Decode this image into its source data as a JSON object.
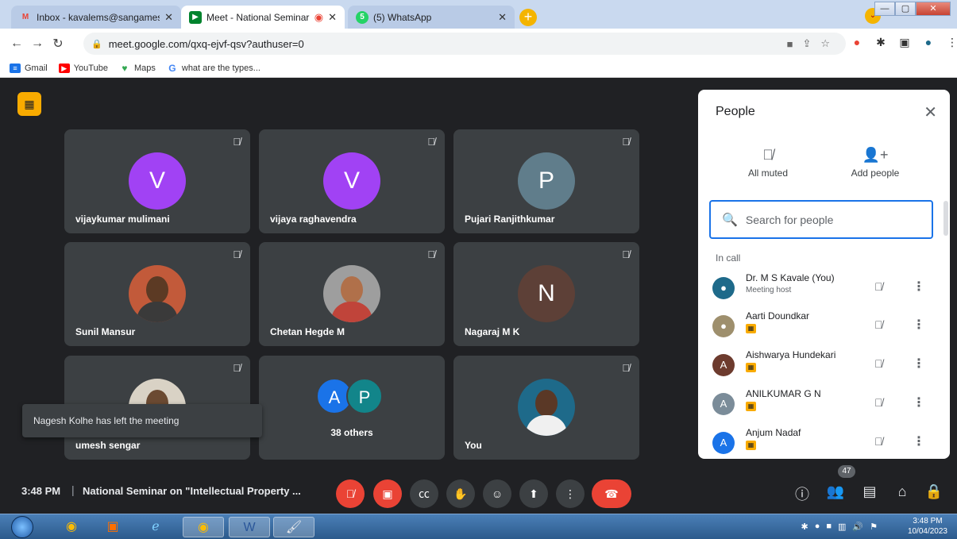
{
  "browser": {
    "tabs": [
      {
        "title": "Inbox - kavalems@sangameshwa",
        "icon": "gmail-icon",
        "state": "inactive"
      },
      {
        "title": "Meet - National Seminar on",
        "icon": "meet-icon",
        "state": "active"
      },
      {
        "title": "(5) WhatsApp",
        "icon": "whatsapp-icon",
        "state": "inactive"
      }
    ],
    "new_tab": "+",
    "url": "meet.google.com/qxq-ejvf-qsv?authuser=0",
    "bookmarks": [
      {
        "label": "Gmail",
        "color": "#1a73e8"
      },
      {
        "label": "YouTube",
        "color": "#ff0000"
      },
      {
        "label": "Maps",
        "color": "#34a853"
      },
      {
        "label": "what are the types...",
        "color": "#4285f4"
      }
    ]
  },
  "meet": {
    "tiles": [
      {
        "name": "vijaykumar mulimani",
        "letter": "V",
        "color": "#a142f4",
        "type": "letter"
      },
      {
        "name": "vijaya raghavendra",
        "letter": "V",
        "color": "#a142f4",
        "type": "letter"
      },
      {
        "name": "Pujari Ranjithkumar",
        "letter": "P",
        "color": "#607d8b",
        "type": "letter"
      },
      {
        "name": "Sunil Mansur",
        "type": "photo"
      },
      {
        "name": "Chetan Hegde M",
        "type": "photo"
      },
      {
        "name": "Nagaraj M K",
        "letter": "N",
        "color": "#5d4037",
        "type": "letter"
      },
      {
        "name": "umesh sengar",
        "type": "photo"
      },
      {
        "name": "38 others",
        "type": "others",
        "letters": [
          "A",
          "P"
        ]
      },
      {
        "name": "You",
        "type": "photo"
      }
    ],
    "toast": "Nagesh Kolhe has left the meeting"
  },
  "panel": {
    "title": "People",
    "all_muted": "All muted",
    "add_people": "Add people",
    "search_placeholder": "Search for people",
    "section": "In call",
    "participants": [
      {
        "name": "Dr. M S Kavale (You)",
        "sub": "Meeting host",
        "avatar": "photo",
        "color": "#1e6a8a"
      },
      {
        "name": "Aarti Doundkar",
        "avatar": "photo",
        "color": "#9e8f6d"
      },
      {
        "name": "Aishwarya Hundekari",
        "letter": "A",
        "color": "#6d3b2e"
      },
      {
        "name": "ANILKUMAR G N",
        "letter": "A",
        "color": "#7b8c99"
      },
      {
        "name": "Anjum Nadaf",
        "letter": "A",
        "color": "#1a73e8"
      }
    ]
  },
  "bottom": {
    "time": "3:48 PM",
    "separator": "|",
    "meeting_title": "National Seminar on \"Intellectual Property ...",
    "people_count": "47"
  },
  "taskbar": {
    "time": "3:48 PM",
    "date": "10/04/2023"
  }
}
